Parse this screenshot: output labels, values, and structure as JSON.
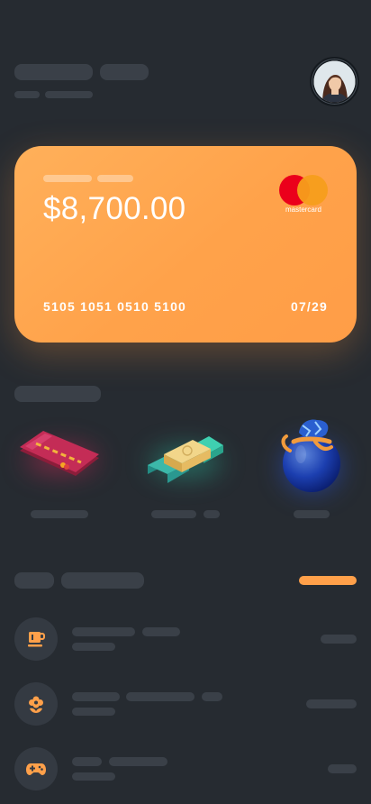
{
  "card": {
    "amount": "$8,700.00",
    "number": "5105 1051 0510 5100",
    "expiry": "07/29",
    "brand": "mastercard"
  },
  "items": [
    {
      "icon": "credit-card-icon"
    },
    {
      "icon": "money-stack-icon"
    },
    {
      "icon": "money-bag-icon"
    }
  ],
  "transactions": [
    {
      "icon": "coffee-cup-icon"
    },
    {
      "icon": "flower-icon"
    },
    {
      "icon": "gamepad-icon"
    }
  ],
  "colors": {
    "background": "#262b31",
    "skeleton": "#3a4048",
    "accent": "#ffa04a",
    "card_start": "#ffb05a",
    "card_end": "#ff9d47"
  }
}
